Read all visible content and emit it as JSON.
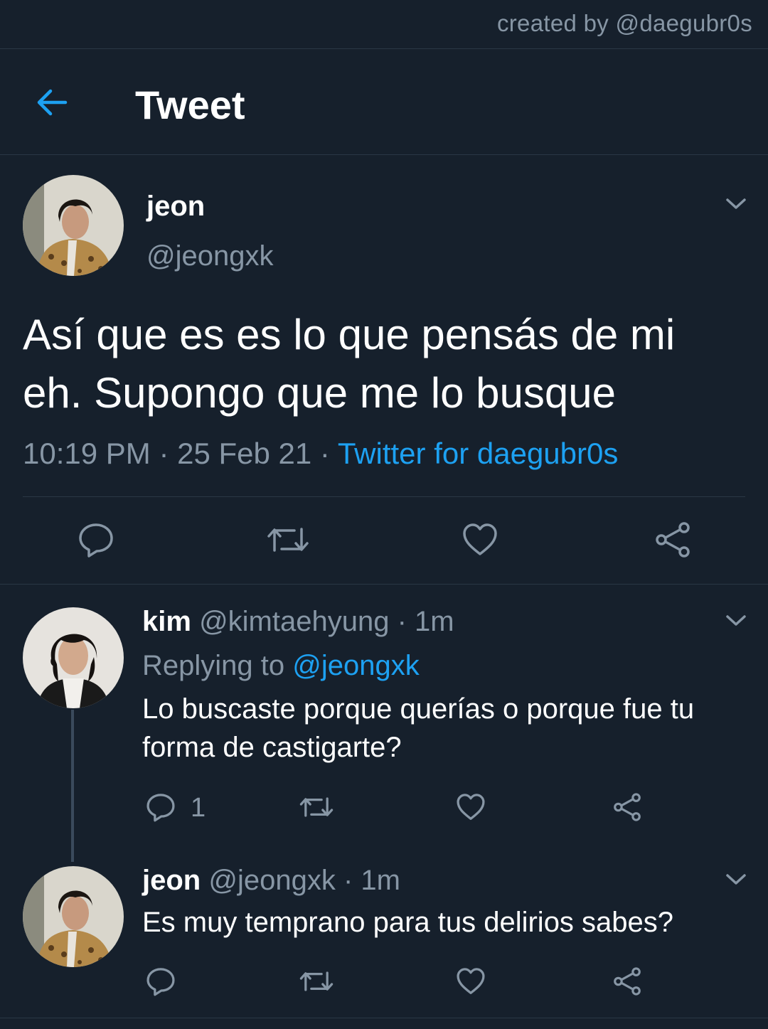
{
  "watermark": "created by @daegubr0s",
  "header": {
    "title": "Tweet",
    "back_icon": "arrow-left-icon"
  },
  "colors": {
    "background": "#16202c",
    "accent": "#1da1f2",
    "muted": "#8796a5"
  },
  "main_tweet": {
    "name": "jeon",
    "handle": "@jeongxk",
    "text": "Así que es es lo que pensás de mi eh. Supongo que me lo busque",
    "time": "10:19 PM",
    "sep1": " · ",
    "date": "25 Feb 21",
    "sep2": " · ",
    "source": "Twitter for daegubr0s"
  },
  "replies": [
    {
      "name": "kim",
      "handle": "@kimtaehyung",
      "age": " · 1m",
      "replying_label": "Replying to ",
      "replying_to": "@jeongxk",
      "text": "Lo buscaste porque querías o porque fue tu forma de castigarte?",
      "reply_count": "1"
    },
    {
      "name": "jeon",
      "handle": "@jeongxk",
      "age": " · 1m",
      "text": "Es muy temprano para tus delirios sabes?"
    }
  ]
}
